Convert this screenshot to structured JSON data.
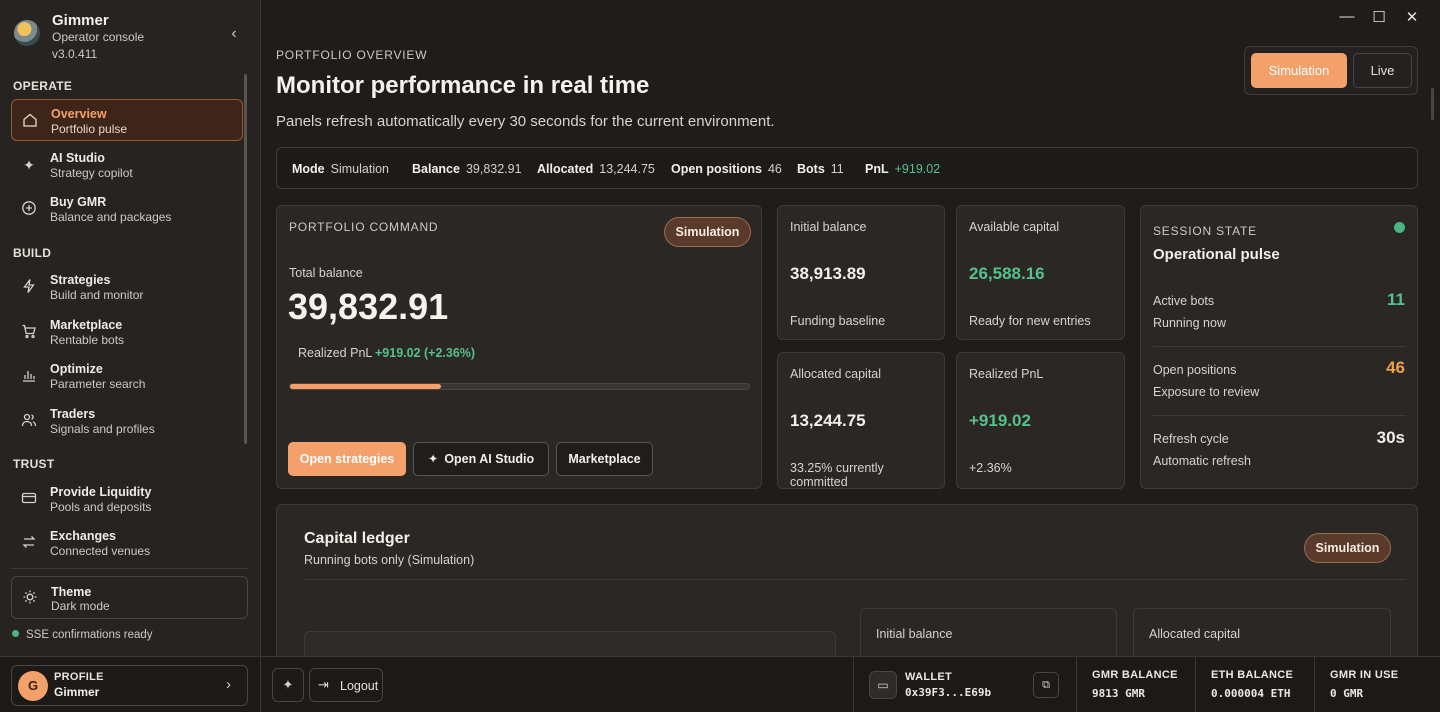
{
  "brand": {
    "name": "Gimmer",
    "subtitle": "Operator console",
    "version": "v3.0.411"
  },
  "sidebar": {
    "sections": {
      "operate": "OPERATE",
      "build": "BUILD",
      "trust": "TRUST"
    },
    "items": [
      {
        "title": "Overview",
        "sub": "Portfolio pulse",
        "icon": "home-icon",
        "active": true
      },
      {
        "title": "AI Studio",
        "sub": "Strategy copilot",
        "icon": "sparkle-icon"
      },
      {
        "title": "Buy GMR",
        "sub": "Balance and packages",
        "icon": "plus-circle-icon"
      },
      {
        "title": "Strategies",
        "sub": "Build and monitor",
        "icon": "lightning-icon"
      },
      {
        "title": "Marketplace",
        "sub": "Rentable bots",
        "icon": "cart-icon"
      },
      {
        "title": "Optimize",
        "sub": "Parameter search",
        "icon": "bar-chart-icon"
      },
      {
        "title": "Traders",
        "sub": "Signals and profiles",
        "icon": "users-icon"
      },
      {
        "title": "Provide Liquidity",
        "sub": "Pools and deposits",
        "icon": "card-icon"
      },
      {
        "title": "Exchanges",
        "sub": "Connected venues",
        "icon": "swap-icon"
      }
    ],
    "theme": {
      "title": "Theme",
      "sub": "Dark mode",
      "icon": "sun-icon"
    },
    "sse_status": "SSE confirmations ready"
  },
  "bottombar": {
    "profile": {
      "label": "PROFILE",
      "name": "Gimmer",
      "initial": "G"
    },
    "logout_label": "Logout",
    "wallet": {
      "label": "WALLET",
      "address": "0x39F3...E69b"
    },
    "gmr_balance": {
      "label": "GMR BALANCE",
      "value": "9813 GMR"
    },
    "eth_balance": {
      "label": "ETH BALANCE",
      "value": "0.000004 ETH"
    },
    "gmr_in_use": {
      "label": "GMR IN USE",
      "value": "0 GMR"
    }
  },
  "header": {
    "eyebrow": "PORTFOLIO OVERVIEW",
    "title": "Monitor performance in real time",
    "description": "Panels refresh automatically every 30 seconds for the current environment.",
    "env_options": [
      "Simulation",
      "Live"
    ],
    "env_selected": "Simulation"
  },
  "stats": {
    "mode_label": "Mode",
    "mode_value": "Simulation",
    "balance_label": "Balance",
    "balance_value": "39,832.91",
    "allocated_label": "Allocated",
    "allocated_value": "13,244.75",
    "positions_label": "Open positions",
    "positions_value": "46",
    "bots_label": "Bots",
    "bots_value": "11",
    "pnl_label": "PnL",
    "pnl_value": "+919.02"
  },
  "portfolio_command": {
    "eyebrow": "PORTFOLIO COMMAND",
    "badge": "Simulation",
    "total_label": "Total balance",
    "total_value": "39,832.91",
    "pnl_label": "Realized PnL",
    "pnl_value": "+919.02 (+2.36%)",
    "progress_fraction": 0.33,
    "buttons": {
      "open_strategies": "Open strategies",
      "open_ai_studio": "Open AI Studio",
      "marketplace": "Marketplace"
    }
  },
  "metrics": [
    {
      "label": "Initial balance",
      "value": "38,913.89",
      "note": "Funding baseline",
      "tone": "neutral"
    },
    {
      "label": "Available capital",
      "value": "26,588.16",
      "note": "Ready for new entries",
      "tone": "green"
    },
    {
      "label": "Allocated capital",
      "value": "13,244.75",
      "note": "33.25% currently committed",
      "tone": "neutral"
    },
    {
      "label": "Realized PnL",
      "value": "+919.02",
      "note": "+2.36%",
      "tone": "green"
    }
  ],
  "session": {
    "eyebrow": "SESSION STATE",
    "title": "Operational pulse",
    "rows": [
      {
        "label": "Active bots",
        "sub": "Running now",
        "value": "11"
      },
      {
        "label": "Open positions",
        "sub": "Exposure to review",
        "value": "46"
      },
      {
        "label": "Refresh cycle",
        "sub": "Automatic refresh",
        "value": "30s"
      }
    ]
  },
  "ledger": {
    "title": "Capital ledger",
    "subtitle": "Running bots only (Simulation)",
    "badge": "Simulation",
    "cards": [
      "Initial balance",
      "Allocated capital"
    ]
  },
  "colors": {
    "accent": "#f4a06a",
    "green": "#58c08a",
    "amber": "#f0a04a",
    "bg": "#1f1d1b"
  }
}
